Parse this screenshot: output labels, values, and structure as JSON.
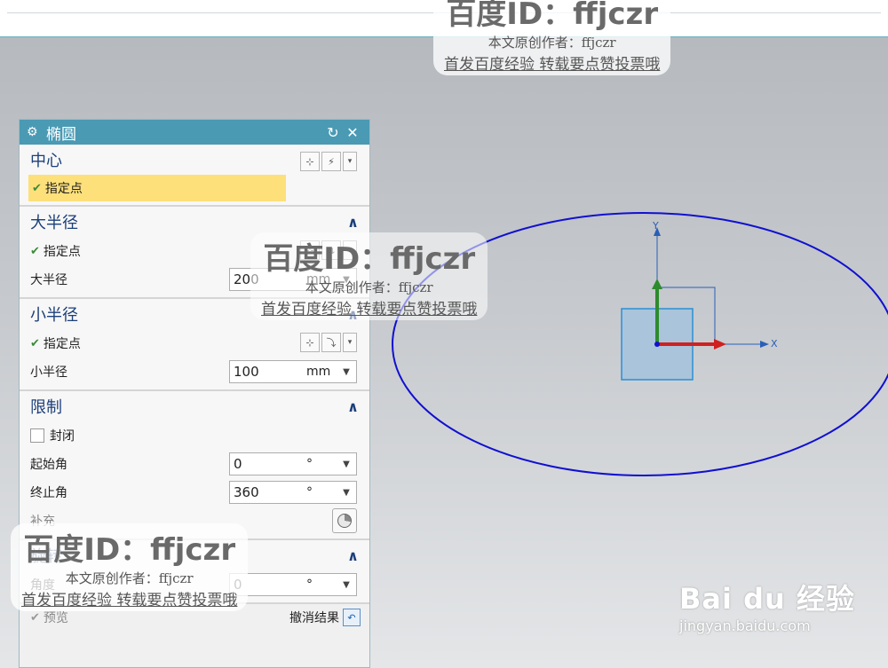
{
  "dialog": {
    "title": "椭圆",
    "sections": {
      "center": {
        "label": "中心",
        "specify_point": "指定点"
      },
      "major": {
        "label": "大半径",
        "specify_point": "指定点",
        "radius_label": "大半径",
        "radius_value": "200",
        "unit": "mm"
      },
      "minor": {
        "label": "小半径",
        "specify_point": "指定点",
        "radius_label": "小半径",
        "radius_value": "100",
        "unit": "mm"
      },
      "limits": {
        "label": "限制",
        "closed_label": "封闭",
        "start_label": "起始角",
        "start_value": "0",
        "end_label": "终止角",
        "end_value": "360",
        "deg": "°",
        "complement_label": "补充"
      },
      "rotate": {
        "label": "旋转",
        "angle_label": "角度",
        "angle_value": "0",
        "deg": "°"
      }
    },
    "preview_label": "预览",
    "undo_label": "撤消结果"
  },
  "axes": {
    "y_label": "Y",
    "x_label": "X"
  },
  "watermarks": {
    "id_text": "百度ID：ffjczr",
    "author": "本文原创作者：ffjczr",
    "tagline": "首发百度经验 转载要点赞投票哦"
  },
  "brand": {
    "logo": "Bai du 经验",
    "url": "jingyan.baidu.com"
  },
  "colors": {
    "title_bar": "#4a9ab4",
    "highlight": "#fde07a",
    "ellipse": "#1010d0",
    "axis_y": "#2e8b2e",
    "axis_x": "#d02020"
  }
}
